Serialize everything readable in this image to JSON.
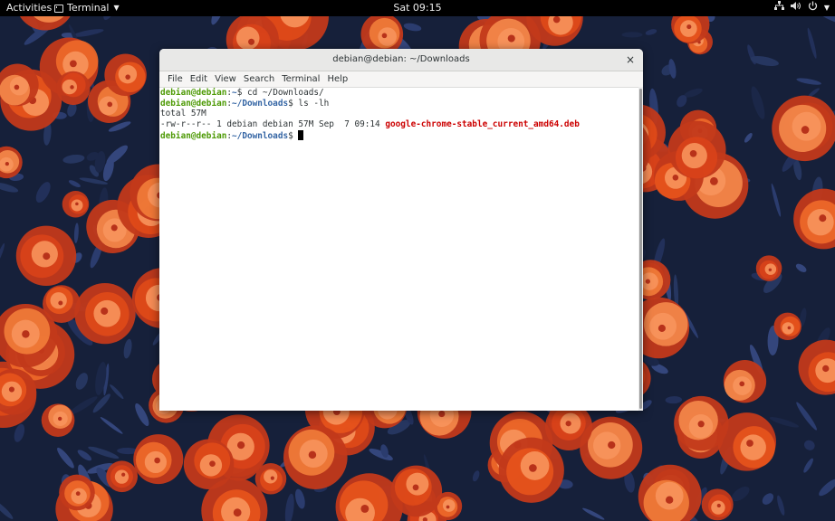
{
  "topbar": {
    "activities": "Activities",
    "app_name": "Terminal",
    "clock": "Sat 09:15",
    "icons": [
      "network-icon",
      "volume-icon",
      "power-icon",
      "menu-caret-icon"
    ]
  },
  "window": {
    "title": "debian@debian: ~/Downloads",
    "close_symbol": "×",
    "menu": [
      "File",
      "Edit",
      "View",
      "Search",
      "Terminal",
      "Help"
    ]
  },
  "terminal": {
    "lines": [
      {
        "user": "debian@debian",
        "sep": ":",
        "path": "~",
        "prompt": "$ ",
        "command": "cd ~/Downloads/"
      },
      {
        "user": "debian@debian",
        "sep": ":",
        "path": "~/Downloads",
        "prompt": "$ ",
        "command": "ls -lh"
      },
      {
        "output": "total 57M"
      },
      {
        "output": "-rw-r--r-- 1 debian debian 57M Sep  7 09:14 ",
        "file": "google-chrome-stable_current_amd64.deb"
      },
      {
        "user": "debian@debian",
        "sep": ":",
        "path": "~/Downloads",
        "prompt": "$ ",
        "command": ""
      }
    ]
  },
  "colors": {
    "prompt_user": "#4e9a06",
    "prompt_path": "#3465a4",
    "deb_file": "#cc0000"
  }
}
